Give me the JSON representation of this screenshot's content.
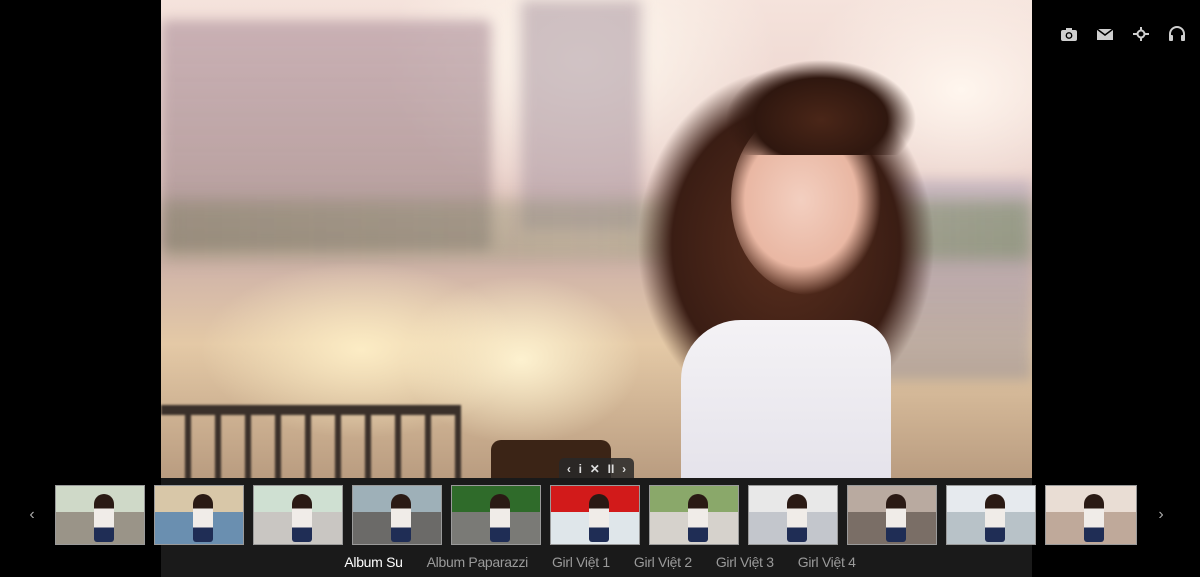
{
  "top_icons": [
    {
      "name": "camera-icon"
    },
    {
      "name": "mail-icon"
    },
    {
      "name": "settings-icon"
    },
    {
      "name": "headphones-icon"
    }
  ],
  "controls": {
    "prev": "‹",
    "info": "i",
    "close": "✕",
    "pause": "II",
    "next": "›"
  },
  "nav": {
    "prev_arrow": "‹",
    "next_arrow": "›"
  },
  "thumbnails": [
    {
      "sky": "#cfd9c8",
      "ground": "#9a9488"
    },
    {
      "sky": "#d8c7a8",
      "ground": "#6a8fb0"
    },
    {
      "sky": "#cfe0d2",
      "ground": "#c9c6c2"
    },
    {
      "sky": "#9eb0b8",
      "ground": "#6b6a68"
    },
    {
      "sky": "#2f6b2a",
      "ground": "#7a7a76"
    },
    {
      "sky": "#d21a1a",
      "ground": "#dfe6ea"
    },
    {
      "sky": "#8aa86a",
      "ground": "#d6d2cc"
    },
    {
      "sky": "#e8e8e8",
      "ground": "#c3c6cc"
    },
    {
      "sky": "#b9aaa0",
      "ground": "#7a6e66"
    },
    {
      "sky": "#e6eaee",
      "ground": "#b8c2c8"
    },
    {
      "sky": "#e9ddd4",
      "ground": "#bfa99a"
    }
  ],
  "albums": [
    {
      "label": "Album Su",
      "active": true
    },
    {
      "label": "Album Paparazzi",
      "active": false
    },
    {
      "label": "Girl Việt 1",
      "active": false
    },
    {
      "label": "Girl Việt 2",
      "active": false
    },
    {
      "label": "Girl Việt 3",
      "active": false
    },
    {
      "label": "Girl Việt 4",
      "active": false
    }
  ]
}
